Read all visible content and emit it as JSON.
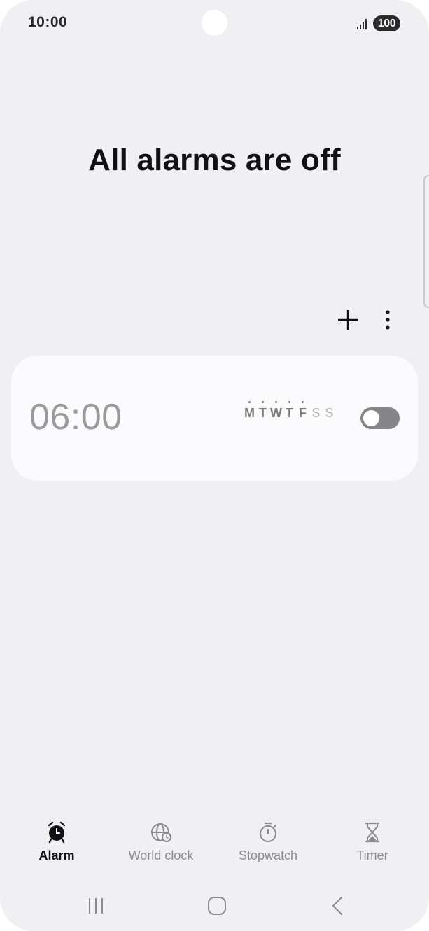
{
  "status_bar": {
    "time": "10:00",
    "battery": "100"
  },
  "header": {
    "title": "All alarms are off",
    "add_icon": "plus-icon",
    "more_icon": "more-vertical-icon"
  },
  "alarms": [
    {
      "time": "06:00",
      "enabled": false,
      "days": [
        {
          "label": "M",
          "active": true
        },
        {
          "label": "T",
          "active": true
        },
        {
          "label": "W",
          "active": true
        },
        {
          "label": "T",
          "active": true
        },
        {
          "label": "F",
          "active": true
        },
        {
          "label": "S",
          "active": false
        },
        {
          "label": "S",
          "active": false
        }
      ]
    }
  ],
  "tabs": [
    {
      "label": "Alarm",
      "icon": "alarm-clock-icon",
      "active": true
    },
    {
      "label": "World clock",
      "icon": "globe-clock-icon",
      "active": false
    },
    {
      "label": "Stopwatch",
      "icon": "stopwatch-icon",
      "active": false
    },
    {
      "label": "Timer",
      "icon": "hourglass-icon",
      "active": false
    }
  ],
  "navigation": {
    "recents_icon": "recent-apps-icon",
    "home_icon": "home-icon",
    "back_icon": "back-icon"
  },
  "colors": {
    "background": "#f0f0f2",
    "card": "#fbfbfd",
    "toggle_off": "#85858a",
    "active_text": "#111111",
    "inactive_text": "#8b8b8f"
  }
}
